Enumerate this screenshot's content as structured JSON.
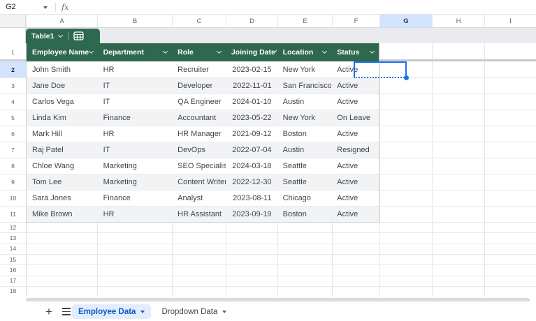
{
  "formula_bar": {
    "cell_reference": "G2",
    "fx_label": "fx"
  },
  "column_letters": [
    "A",
    "B",
    "C",
    "D",
    "E",
    "F",
    "G",
    "H",
    "I"
  ],
  "row_numbers": [
    "1",
    "2",
    "3",
    "4",
    "5",
    "6",
    "7",
    "8",
    "9",
    "10",
    "11",
    "12",
    "13",
    "14",
    "15",
    "16",
    "17",
    "18"
  ],
  "selected_column": "G",
  "selected_row": "2",
  "selected_cell": "G2",
  "table": {
    "name": "Table1",
    "headers": [
      "Employee Name",
      "Department",
      "Role",
      "Joining Date",
      "Location",
      "Status"
    ],
    "rows": [
      [
        "John Smith",
        "HR",
        "Recruiter",
        "2023-02-15",
        "New York",
        "Active"
      ],
      [
        "Jane Doe",
        "IT",
        "Developer",
        "2022-11-01",
        "San Francisco",
        "Active"
      ],
      [
        "Carlos Vega",
        "IT",
        "QA Engineer",
        "2024-01-10",
        "Austin",
        "Active"
      ],
      [
        "Linda Kim",
        "Finance",
        "Accountant",
        "2023-05-22",
        "New York",
        "On Leave"
      ],
      [
        "Mark Hill",
        "HR",
        "HR Manager",
        "2021-09-12",
        "Boston",
        "Active"
      ],
      [
        "Raj Patel",
        "IT",
        "DevOps",
        "2022-07-04",
        "Austin",
        "Resigned"
      ],
      [
        "Chloe Wang",
        "Marketing",
        "SEO Specialist",
        "2024-03-18",
        "Seattle",
        "Active"
      ],
      [
        "Tom Lee",
        "Marketing",
        "Content Writer",
        "2022-12-30",
        "Seattle",
        "Active"
      ],
      [
        "Sara Jones",
        "Finance",
        "Analyst",
        "2023-08-11",
        "Chicago",
        "Active"
      ],
      [
        "Mike Brown",
        "HR",
        "HR Assistant",
        "2023-09-19",
        "Boston",
        "Active"
      ]
    ]
  },
  "sheet_tabs": [
    {
      "label": "Employee Data",
      "active": true
    },
    {
      "label": "Dropdown Data",
      "active": false
    }
  ],
  "icons": {
    "name_box_arrow": "triangle-down",
    "formula_icon": "fx-italic",
    "pill_dropdown": "chevron-down",
    "pill_table_icon": "table-grid",
    "header_dropdown": "chevron-down",
    "add_sheet": "plus",
    "all_sheets_menu": "hamburger",
    "tab_arrow": "triangle-down",
    "fill_handle": "blue-dot"
  },
  "colors": {
    "table_green": "#2e684f",
    "selection_blue": "#1a73e8",
    "header_highlight_blue": "#d3e3fd",
    "row_band_gray": "#f2f3f5",
    "active_tab_bg": "#e4edfb",
    "active_tab_text": "#0b57d0"
  }
}
